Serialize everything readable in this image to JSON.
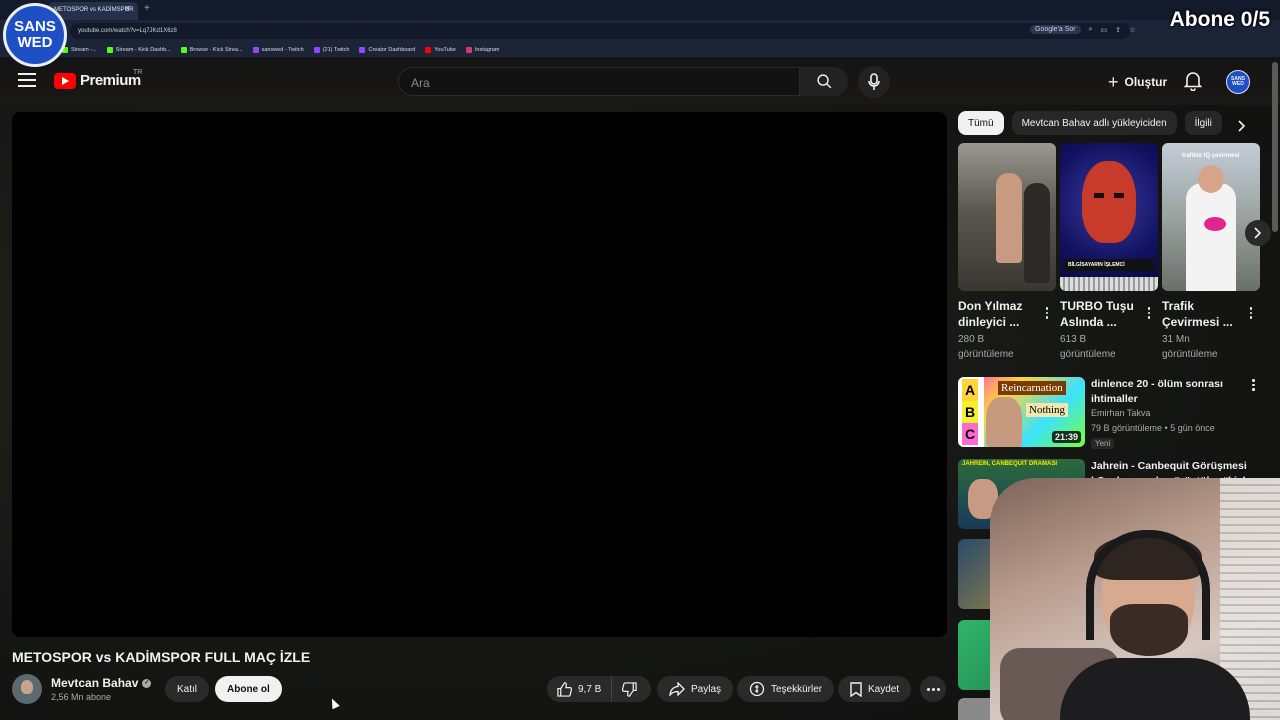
{
  "browser": {
    "tab_title": "METOSPOR vs KADİMSPOR",
    "url": "youtube.com/watch?v=Lq7JKd1X6z8",
    "google_sor": "Google'a Sor",
    "bookmarks": [
      {
        "label": "Stream -...",
        "color": "#53fc18"
      },
      {
        "label": "Stream - Kick Dashb...",
        "color": "#53fc18"
      },
      {
        "label": "Browse - Kick Strea...",
        "color": "#53fc18"
      },
      {
        "label": "sanswed - Twitch",
        "color": "#9146ff"
      },
      {
        "label": "(21) Twitch",
        "color": "#9146ff"
      },
      {
        "label": "Creator Dashboard",
        "color": "#9146ff"
      },
      {
        "label": "YouTube",
        "color": "#ff0000"
      },
      {
        "label": "Instagram",
        "color": "#e1306c"
      }
    ]
  },
  "overlay": {
    "logo_line1": "SANS",
    "logo_line2": "WED",
    "abone_counter": "Abone 0/5"
  },
  "header": {
    "brand": "Premium",
    "region": "TR",
    "search_placeholder": "Ara",
    "create_label": "Oluştur",
    "avatar_line1": "SANS",
    "avatar_line2": "WED"
  },
  "video": {
    "title": "METOSPOR vs KADİMSPOR FULL MAÇ İZLE",
    "channel": "Mevtcan Bahav",
    "subscribers": "2,56 Mn abone",
    "join_label": "Katıl",
    "subscribe_label": "Abone ol",
    "likes": "9,7 B",
    "share_label": "Paylaş",
    "thanks_label": "Teşekkürler",
    "save_label": "Kaydet"
  },
  "chips": [
    "Tümü",
    "Mevtcan Bahav adlı yükleyiciden",
    "İlgili"
  ],
  "shorts": [
    {
      "title": "Don Yılmaz dinleyici ...",
      "views": "280 B görüntüleme",
      "thumb_color": "#6f6a60"
    },
    {
      "title": "TURBO Tuşu Aslında ...",
      "views": "613 B görüntüleme",
      "thumb_color": "#1a1a5a",
      "caption": "BİLGİSAYARIN İŞLEMCİ"
    },
    {
      "title": "Trafik Çevirmesi ...",
      "views": "31 Mn görüntüleme",
      "thumb_color": "#b7b9b4",
      "caption": "trafikte IQ çevirmesi"
    }
  ],
  "recommended": [
    {
      "title": "dinlence 20 - ölüm sonrası ihtimaller",
      "channel": "Emirhan Takva",
      "meta": "79 B görüntüleme • 5 gün önce",
      "badge": "Yeni",
      "duration": "21:39",
      "thumb_text1": "Reincarnation",
      "thumb_text2": "Nothing",
      "thumb_letters": [
        "A",
        "B",
        "C"
      ]
    },
    {
      "title": "Jahrein - Canbequit Görüşmesi | Canlı yayında görüştüler #kick ...",
      "thumb_text1": "JAHREIN, CANBEQUIT DRAMASI"
    }
  ]
}
